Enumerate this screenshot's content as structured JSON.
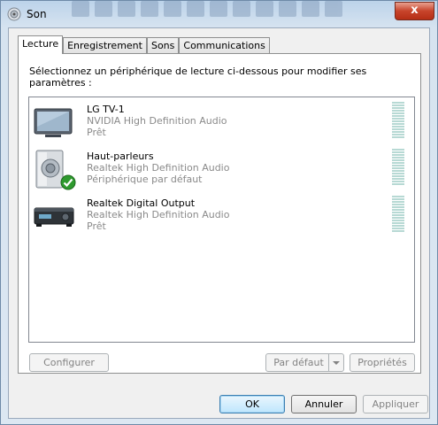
{
  "window": {
    "title": "Son",
    "close_glyph": "x",
    "app_icon": "speaker-icon"
  },
  "tabs": [
    {
      "label": "Lecture",
      "active": true
    },
    {
      "label": "Enregistrement",
      "active": false
    },
    {
      "label": "Sons",
      "active": false
    },
    {
      "label": "Communications",
      "active": false
    }
  ],
  "playback": {
    "instruction": "Sélectionnez un périphérique de lecture ci-dessous pour modifier ses paramètres :",
    "devices": [
      {
        "name": "LG TV-1",
        "driver": "NVIDIA High Definition Audio",
        "status": "Prêt",
        "icon": "tv-icon",
        "default": false
      },
      {
        "name": "Haut-parleurs",
        "driver": "Realtek High Definition Audio",
        "status": "Périphérique par défaut",
        "icon": "speaker-icon",
        "default": true
      },
      {
        "name": "Realtek Digital Output",
        "driver": "Realtek High Definition Audio",
        "status": "Prêt",
        "icon": "receiver-icon",
        "default": false
      }
    ]
  },
  "buttons": {
    "configure": "Configurer",
    "set_default": "Par défaut",
    "properties": "Propriétés",
    "ok": "OK",
    "cancel": "Annuler",
    "apply": "Appliquer"
  },
  "colors": {
    "accent": "#3c7fb1",
    "default_check": "#2e9a2e",
    "meter": "#b7d9d4"
  }
}
